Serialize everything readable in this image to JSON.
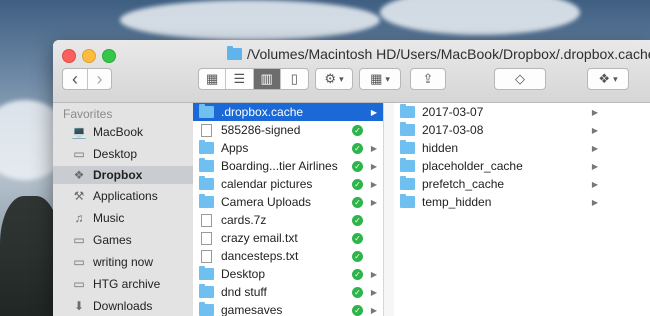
{
  "window": {
    "title": "/Volumes/Macintosh HD/Users/MacBook/Dropbox/.dropbox.cache"
  },
  "toolbar": {
    "back": "‹",
    "forward": "›",
    "view_icons": "▦",
    "view_list": "☰",
    "view_columns": "▥",
    "view_coverflow": "▯",
    "action": "⚙",
    "arrange": "▦",
    "share": "⇪",
    "tag": "◇",
    "dropbox": "❖",
    "dropdown": "▾"
  },
  "sidebar": {
    "header": "Favorites",
    "items": [
      {
        "label": "MacBook",
        "icon": "laptop-icon"
      },
      {
        "label": "Desktop",
        "icon": "desktop-icon"
      },
      {
        "label": "Dropbox",
        "icon": "dropbox-icon"
      },
      {
        "label": "Applications",
        "icon": "applications-icon"
      },
      {
        "label": "Music",
        "icon": "music-icon"
      },
      {
        "label": "Games",
        "icon": "folder-icon"
      },
      {
        "label": "writing now",
        "icon": "folder-icon"
      },
      {
        "label": "HTG archive",
        "icon": "folder-icon"
      },
      {
        "label": "Downloads",
        "icon": "downloads-icon"
      }
    ],
    "selected": "Dropbox"
  },
  "column1": {
    "items": [
      {
        "label": ".dropbox.cache",
        "type": "folder",
        "synced": false,
        "has_children": true,
        "selected": true
      },
      {
        "label": "585286-signed",
        "type": "file",
        "synced": true,
        "has_children": false
      },
      {
        "label": "Apps",
        "type": "folder",
        "synced": true,
        "has_children": true
      },
      {
        "label": "Boarding...tier Airlines",
        "type": "folder",
        "synced": true,
        "has_children": true
      },
      {
        "label": "calendar pictures",
        "type": "folder",
        "synced": true,
        "has_children": true
      },
      {
        "label": "Camera Uploads",
        "type": "folder",
        "synced": true,
        "has_children": true
      },
      {
        "label": "cards.7z",
        "type": "file",
        "synced": true,
        "has_children": false
      },
      {
        "label": "crazy email.txt",
        "type": "file",
        "synced": true,
        "has_children": false
      },
      {
        "label": "dancesteps.txt",
        "type": "file",
        "synced": true,
        "has_children": false
      },
      {
        "label": "Desktop",
        "type": "folder",
        "synced": true,
        "has_children": true
      },
      {
        "label": "dnd stuff",
        "type": "folder",
        "synced": true,
        "has_children": true
      },
      {
        "label": "gamesaves",
        "type": "folder",
        "synced": true,
        "has_children": true
      }
    ]
  },
  "column2": {
    "items": [
      {
        "label": "2017-03-07",
        "has_children": true
      },
      {
        "label": "2017-03-08",
        "has_children": true
      },
      {
        "label": "hidden",
        "has_children": true
      },
      {
        "label": "placeholder_cache",
        "has_children": true
      },
      {
        "label": "prefetch_cache",
        "has_children": true
      },
      {
        "label": "temp_hidden",
        "has_children": true
      }
    ]
  },
  "colors": {
    "selection": "#1a69d6",
    "folder": "#6fbff0",
    "synced": "#2fb34a"
  }
}
